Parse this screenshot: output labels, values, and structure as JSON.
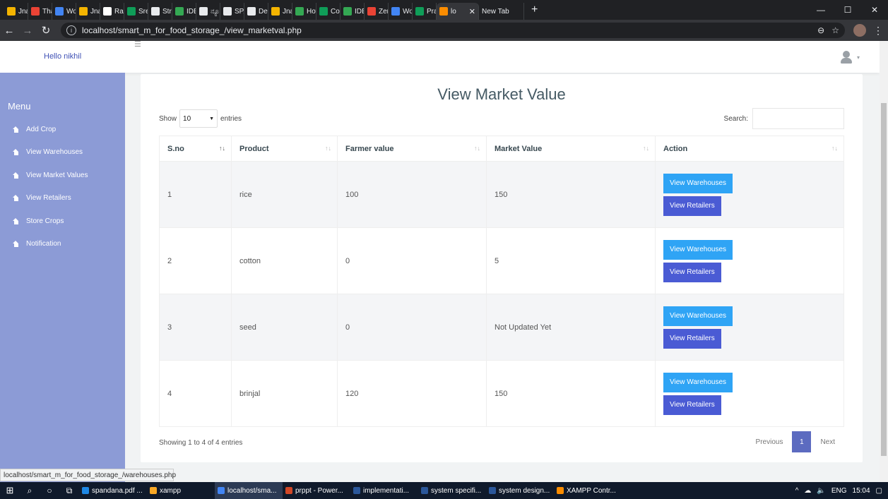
{
  "browser": {
    "tabs": [
      {
        "label": "Jnan",
        "color": "#f4b400"
      },
      {
        "label": "Than",
        "color": "#ea4335"
      },
      {
        "label": "Worl",
        "color": "#4285f4"
      },
      {
        "label": "Jnan",
        "color": "#f4b400"
      },
      {
        "label": "Ram",
        "color": "#ffffff"
      },
      {
        "label": "Sree",
        "color": "#0f9d58"
      },
      {
        "label": "Strar",
        "color": "#e8eaed"
      },
      {
        "label": "IDE |",
        "color": "#34a853"
      },
      {
        "label": "ನ್ಯೂಸ್",
        "color": "#e8eaed"
      },
      {
        "label": "SPAI",
        "color": "#e8eaed"
      },
      {
        "label": "Dep",
        "color": "#e8eaed"
      },
      {
        "label": "Jnan",
        "color": "#f4b400"
      },
      {
        "label": "How",
        "color": "#34a853"
      },
      {
        "label": "Cour",
        "color": "#0f9d58"
      },
      {
        "label": "IDE |",
        "color": "#34a853"
      },
      {
        "label": "Zenc",
        "color": "#ea4335"
      },
      {
        "label": "Worl",
        "color": "#4285f4"
      },
      {
        "label": "Prat",
        "color": "#0f9d58"
      }
    ],
    "active_tab": {
      "label": "lo",
      "color": "#fb8c00"
    },
    "new_tab_label": "New Tab",
    "url": "localhost/smart_m_for_food_storage_/view_marketval.php"
  },
  "header": {
    "greeting": "Hello nikhil"
  },
  "sidebar": {
    "title": "Menu",
    "items": [
      {
        "label": "Add Crop"
      },
      {
        "label": "View Warehouses"
      },
      {
        "label": "View Market Values"
      },
      {
        "label": "View Retailers"
      },
      {
        "label": "Store Crops"
      },
      {
        "label": "Notification"
      }
    ]
  },
  "main": {
    "title": "View Market Value",
    "show_label": "Show",
    "entries_value": "10",
    "entries_label": "entries",
    "search_label": "Search:",
    "columns": [
      "S.no",
      "Product",
      "Farmer value",
      "Market Value",
      "Action"
    ],
    "rows": [
      {
        "sno": "1",
        "product": "rice",
        "farmer_value": "100",
        "market_value": "150"
      },
      {
        "sno": "2",
        "product": "cotton",
        "farmer_value": "0",
        "market_value": "5"
      },
      {
        "sno": "3",
        "product": "seed",
        "farmer_value": "0",
        "market_value": "Not Updated Yet"
      },
      {
        "sno": "4",
        "product": "brinjal",
        "farmer_value": "120",
        "market_value": "150"
      }
    ],
    "btn_warehouses": "View Warehouses",
    "btn_retailers": "View Retailers",
    "info": "Showing 1 to 4 of 4 entries",
    "pagination": {
      "previous": "Previous",
      "current": "1",
      "next": "Next"
    }
  },
  "status_bar": "localhost/smart_m_for_food_storage_/warehouses.php",
  "taskbar": {
    "apps": [
      {
        "label": "spandana.pdf ...",
        "color": "#1e88e5"
      },
      {
        "label": "xampp",
        "color": "#f9a825"
      },
      {
        "label": "localhost/sma...",
        "color": "#4285f4"
      },
      {
        "label": "prppt - Power...",
        "color": "#d24726"
      },
      {
        "label": "implementati...",
        "color": "#2b579a"
      },
      {
        "label": "system specifi...",
        "color": "#2b579a"
      },
      {
        "label": "system design...",
        "color": "#2b579a"
      },
      {
        "label": "XAMPP Contr...",
        "color": "#fb8c00"
      }
    ],
    "lang": "ENG",
    "time": "15:04"
  }
}
